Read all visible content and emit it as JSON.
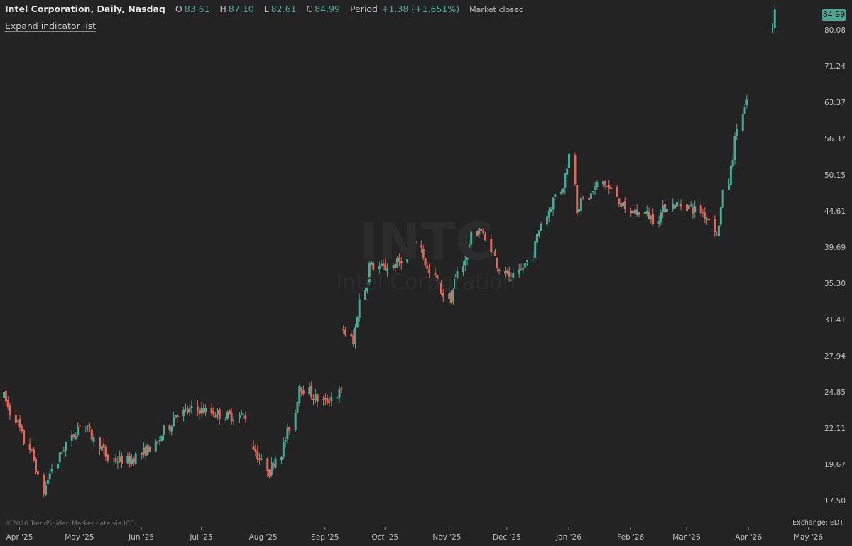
{
  "header": {
    "title": "Intel Corporation, Daily, Nasdaq",
    "open_label": "O",
    "open_value": "83.61",
    "high_label": "H",
    "high_value": "87.10",
    "low_label": "L",
    "low_value": "82.61",
    "close_label": "C",
    "close_value": "84.99",
    "period_label": "Period",
    "period_value": "+1.38 (+1.651%)",
    "market_status": "Market closed"
  },
  "expand_label": "Expand indicator list",
  "watermark": {
    "ticker": "INTC",
    "name": "Intel Corporation"
  },
  "price_tag": "84.99",
  "copyright": "©2026 TrendSpider. Market data via ICE.",
  "exchange_label": "Exchange: EDT",
  "colors": {
    "up": "#4aa894",
    "down": "#e0675c",
    "background": "#232323",
    "text": "#c9c9c9",
    "accent": "#4aa894"
  },
  "chart_data": {
    "type": "candlestick",
    "title": "Intel Corporation, Daily, Nasdaq",
    "y_axis": {
      "scale": "log",
      "ticks": [
        "17.50",
        "19.67",
        "22.11",
        "24.85",
        "27.94",
        "31.41",
        "35.30",
        "39.69",
        "44.61",
        "50.15",
        "56.37",
        "63.37",
        "71.24",
        "80.08"
      ],
      "range": [
        16.3,
        87.5
      ]
    },
    "x_axis": {
      "ticks": [
        "Apr '25",
        "May '25",
        "Jun '25",
        "Jul '25",
        "Aug '25",
        "Sep '25",
        "Oct '25",
        "Nov '25",
        "Dec '25",
        "Jan '26",
        "Feb '26",
        "Mar '26",
        "Apr '26",
        "May '26"
      ]
    },
    "segments": [
      {
        "from": "2025-04-01",
        "to": "2025-07-31",
        "start": 24.5,
        "anchors": [
          [
            0,
            24.5
          ],
          [
            12,
            19.5
          ],
          [
            14,
            18.0
          ],
          [
            20,
            20.2
          ],
          [
            28,
            22.5
          ],
          [
            38,
            20.0
          ],
          [
            45,
            19.9
          ],
          [
            55,
            21.0
          ],
          [
            62,
            23.2
          ],
          [
            70,
            23.5
          ],
          [
            80,
            23.0
          ]
        ]
      },
      {
        "from": "2025-08-04",
        "to": "2025-09-17",
        "start": 20.8,
        "anchors": [
          [
            0,
            20.8
          ],
          [
            6,
            19.2
          ],
          [
            10,
            20.5
          ],
          [
            14,
            22.2
          ],
          [
            17,
            25.5
          ],
          [
            22,
            24.5
          ],
          [
            26,
            24.0
          ],
          [
            31,
            24.8
          ]
        ]
      },
      {
        "from": "2025-09-18",
        "to": "2026-04-08",
        "start": 30.5,
        "anchors": [
          [
            0,
            30.5
          ],
          [
            3,
            29.0
          ],
          [
            5,
            32.0
          ],
          [
            9,
            37.5
          ],
          [
            14,
            37.0
          ],
          [
            20,
            37.8
          ],
          [
            26,
            40.5
          ],
          [
            30,
            36.8
          ],
          [
            36,
            34.0
          ],
          [
            38,
            33.6
          ],
          [
            44,
            39.5
          ],
          [
            48,
            42.5
          ],
          [
            55,
            37.6
          ],
          [
            60,
            35.5
          ],
          [
            66,
            38.0
          ],
          [
            72,
            44.0
          ],
          [
            78,
            48.5
          ],
          [
            81,
            53.5
          ],
          [
            83,
            45.0
          ],
          [
            88,
            47.0
          ],
          [
            92,
            49.0
          ],
          [
            96,
            47.5
          ],
          [
            101,
            44.5
          ],
          [
            106,
            44.5
          ],
          [
            111,
            43.5
          ],
          [
            116,
            45.5
          ],
          [
            121,
            45.5
          ],
          [
            126,
            44.8
          ],
          [
            131,
            43.5
          ],
          [
            133,
            41.0
          ],
          [
            138,
            51.0
          ],
          [
            142,
            61.0
          ],
          [
            146,
            65.0
          ],
          [
            150,
            67.0
          ],
          [
            152,
            66.5
          ]
        ]
      },
      {
        "from": "2026-04-21",
        "to": "2026-04-22",
        "start": 80.5,
        "anchors": [
          [
            0,
            80.5
          ],
          [
            1,
            84.99
          ]
        ]
      }
    ]
  }
}
